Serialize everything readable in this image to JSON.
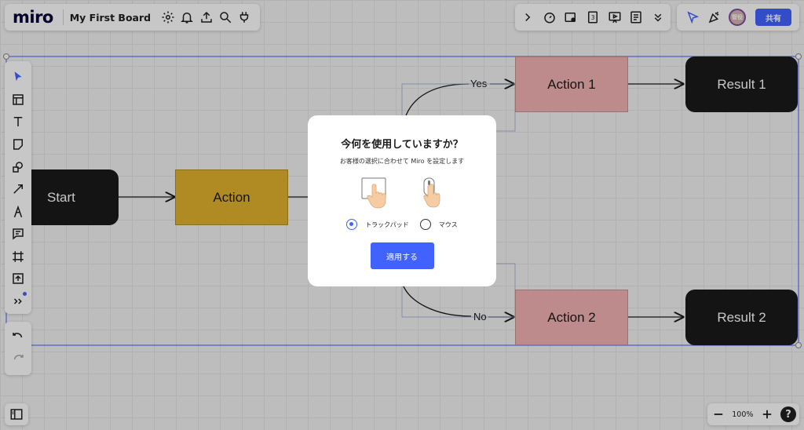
{
  "header": {
    "logo": "miro",
    "board_title": "My First Board"
  },
  "toolbar_right": {
    "avatar_initials": "管役",
    "share_label": "共有"
  },
  "board": {
    "start_label": "Start",
    "action_label": "Action",
    "action1_label": "Action 1",
    "action2_label": "Action 2",
    "result1_label": "Result 1",
    "result2_label": "Result 2",
    "yes_label": "Yes",
    "no_label": "No"
  },
  "dialog": {
    "title": "今何を使用していますか？",
    "subtitle": "お客様の選択に合わせて Miro を設定します",
    "option_trackpad": "トラックパッド",
    "option_mouse": "マウス",
    "selected": "trackpad",
    "apply_label": "適用する"
  },
  "zoom": {
    "level": "100%"
  },
  "colors": {
    "accent": "#4262ff",
    "start_result": "#1a1a1a",
    "action": "#e2b32d",
    "branch_action": "#f2b3b4"
  }
}
